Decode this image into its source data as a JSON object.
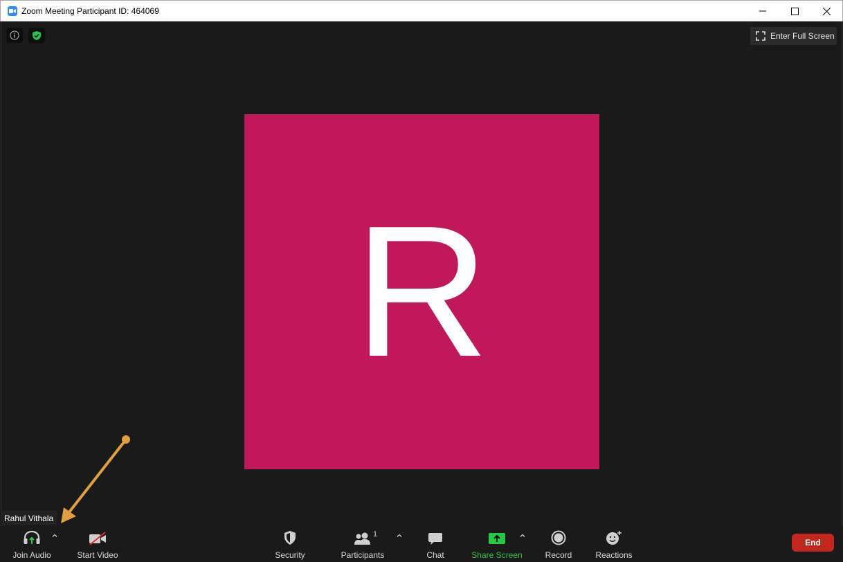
{
  "window": {
    "title": "Zoom Meeting Participant ID: 464069"
  },
  "top_bar": {
    "info_icon": "info-icon",
    "security_shield_icon": "shield-check-icon",
    "full_screen_label": "Enter Full Screen"
  },
  "video": {
    "avatar_letter": "R",
    "avatar_color": "#c0185a",
    "participant_name": "Rahul Vithala"
  },
  "toolbar": {
    "join_audio": "Join Audio",
    "start_video": "Start Video",
    "security": "Security",
    "participants": "Participants",
    "participants_count": "1",
    "chat": "Chat",
    "share_screen": "Share Screen",
    "record": "Record",
    "reactions": "Reactions",
    "end": "End"
  },
  "colors": {
    "share_green": "#26c944",
    "end_red": "#c0281f",
    "annotation_arrow": "#e0a040"
  }
}
